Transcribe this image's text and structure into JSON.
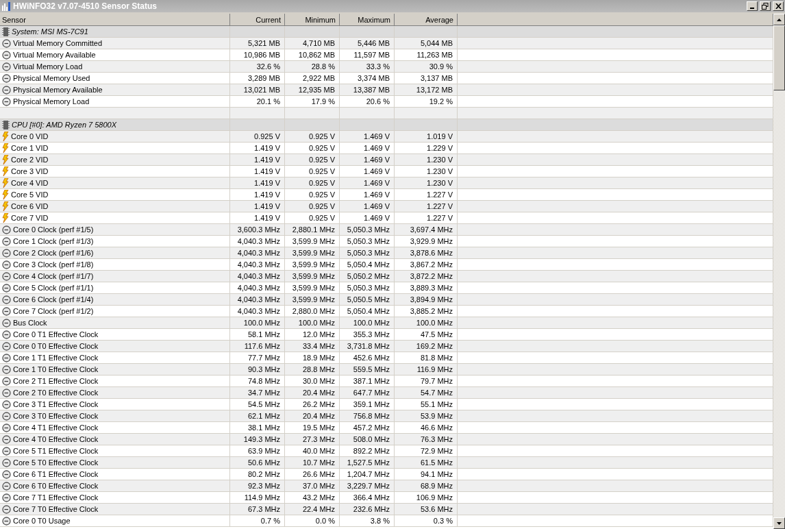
{
  "window": {
    "title": "HWiNFO32 v7.07-4510 Sensor Status"
  },
  "table": {
    "columns": [
      "Sensor",
      "Current",
      "Minimum",
      "Maximum",
      "Average"
    ],
    "rows": [
      {
        "kind": "group",
        "sensor": "System: MSI MS-7C91"
      },
      {
        "kind": "gauge",
        "sensor": "Virtual Memory Committed",
        "current": "5,321 MB",
        "minimum": "4,710 MB",
        "maximum": "5,446 MB",
        "average": "5,044 MB"
      },
      {
        "kind": "gauge",
        "sensor": "Virtual Memory Available",
        "current": "10,986 MB",
        "minimum": "10,862 MB",
        "maximum": "11,597 MB",
        "average": "11,263 MB"
      },
      {
        "kind": "gauge",
        "sensor": "Virtual Memory Load",
        "current": "32.6 %",
        "minimum": "28.8 %",
        "maximum": "33.3 %",
        "average": "30.9 %"
      },
      {
        "kind": "gauge",
        "sensor": "Physical Memory Used",
        "current": "3,289 MB",
        "minimum": "2,922 MB",
        "maximum": "3,374 MB",
        "average": "3,137 MB"
      },
      {
        "kind": "gauge",
        "sensor": "Physical Memory Available",
        "current": "13,021 MB",
        "minimum": "12,935 MB",
        "maximum": "13,387 MB",
        "average": "13,172 MB"
      },
      {
        "kind": "gauge",
        "sensor": "Physical Memory Load",
        "current": "20.1 %",
        "minimum": "17.9 %",
        "maximum": "20.6 %",
        "average": "19.2 %"
      },
      {
        "kind": "spacer"
      },
      {
        "kind": "group",
        "sensor": "CPU [#0]: AMD Ryzen 7 5800X"
      },
      {
        "kind": "voltage",
        "sensor": "Core 0 VID",
        "current": "0.925 V",
        "minimum": "0.925 V",
        "maximum": "1.469 V",
        "average": "1.019 V"
      },
      {
        "kind": "voltage",
        "sensor": "Core 1 VID",
        "current": "1.419 V",
        "minimum": "0.925 V",
        "maximum": "1.469 V",
        "average": "1.229 V"
      },
      {
        "kind": "voltage",
        "sensor": "Core 2 VID",
        "current": "1.419 V",
        "minimum": "0.925 V",
        "maximum": "1.469 V",
        "average": "1.230 V"
      },
      {
        "kind": "voltage",
        "sensor": "Core 3 VID",
        "current": "1.419 V",
        "minimum": "0.925 V",
        "maximum": "1.469 V",
        "average": "1.230 V"
      },
      {
        "kind": "voltage",
        "sensor": "Core 4 VID",
        "current": "1.419 V",
        "minimum": "0.925 V",
        "maximum": "1.469 V",
        "average": "1.230 V"
      },
      {
        "kind": "voltage",
        "sensor": "Core 5 VID",
        "current": "1.419 V",
        "minimum": "0.925 V",
        "maximum": "1.469 V",
        "average": "1.227 V"
      },
      {
        "kind": "voltage",
        "sensor": "Core 6 VID",
        "current": "1.419 V",
        "minimum": "0.925 V",
        "maximum": "1.469 V",
        "average": "1.227 V"
      },
      {
        "kind": "voltage",
        "sensor": "Core 7 VID",
        "current": "1.419 V",
        "minimum": "0.925 V",
        "maximum": "1.469 V",
        "average": "1.227 V"
      },
      {
        "kind": "gauge",
        "sensor": "Core 0 Clock (perf #1/5)",
        "current": "3,600.3 MHz",
        "minimum": "2,880.1 MHz",
        "maximum": "5,050.3 MHz",
        "average": "3,697.4 MHz"
      },
      {
        "kind": "gauge",
        "sensor": "Core 1 Clock (perf #1/3)",
        "current": "4,040.3 MHz",
        "minimum": "3,599.9 MHz",
        "maximum": "5,050.3 MHz",
        "average": "3,929.9 MHz"
      },
      {
        "kind": "gauge",
        "sensor": "Core 2 Clock (perf #1/6)",
        "current": "4,040.3 MHz",
        "minimum": "3,599.9 MHz",
        "maximum": "5,050.3 MHz",
        "average": "3,878.6 MHz"
      },
      {
        "kind": "gauge",
        "sensor": "Core 3 Clock (perf #1/8)",
        "current": "4,040.3 MHz",
        "minimum": "3,599.9 MHz",
        "maximum": "5,050.4 MHz",
        "average": "3,867.2 MHz"
      },
      {
        "kind": "gauge",
        "sensor": "Core 4 Clock (perf #1/7)",
        "current": "4,040.3 MHz",
        "minimum": "3,599.9 MHz",
        "maximum": "5,050.2 MHz",
        "average": "3,872.2 MHz"
      },
      {
        "kind": "gauge",
        "sensor": "Core 5 Clock (perf #1/1)",
        "current": "4,040.3 MHz",
        "minimum": "3,599.9 MHz",
        "maximum": "5,050.3 MHz",
        "average": "3,889.3 MHz"
      },
      {
        "kind": "gauge",
        "sensor": "Core 6 Clock (perf #1/4)",
        "current": "4,040.3 MHz",
        "minimum": "3,599.9 MHz",
        "maximum": "5,050.5 MHz",
        "average": "3,894.9 MHz"
      },
      {
        "kind": "gauge",
        "sensor": "Core 7 Clock (perf #1/2)",
        "current": "4,040.3 MHz",
        "minimum": "2,880.0 MHz",
        "maximum": "5,050.4 MHz",
        "average": "3,885.2 MHz"
      },
      {
        "kind": "gauge",
        "sensor": "Bus Clock",
        "current": "100.0 MHz",
        "minimum": "100.0 MHz",
        "maximum": "100.0 MHz",
        "average": "100.0 MHz"
      },
      {
        "kind": "gauge",
        "sensor": "Core 0 T1 Effective Clock",
        "current": "58.1 MHz",
        "minimum": "12.0 MHz",
        "maximum": "355.3 MHz",
        "average": "47.5 MHz"
      },
      {
        "kind": "gauge",
        "sensor": "Core 0 T0 Effective Clock",
        "current": "117.6 MHz",
        "minimum": "33.4 MHz",
        "maximum": "3,731.8 MHz",
        "average": "169.2 MHz"
      },
      {
        "kind": "gauge",
        "sensor": "Core 1 T1 Effective Clock",
        "current": "77.7 MHz",
        "minimum": "18.9 MHz",
        "maximum": "452.6 MHz",
        "average": "81.8 MHz"
      },
      {
        "kind": "gauge",
        "sensor": "Core 1 T0 Effective Clock",
        "current": "90.3 MHz",
        "minimum": "28.8 MHz",
        "maximum": "559.5 MHz",
        "average": "116.9 MHz"
      },
      {
        "kind": "gauge",
        "sensor": "Core 2 T1 Effective Clock",
        "current": "74.8 MHz",
        "minimum": "30.0 MHz",
        "maximum": "387.1 MHz",
        "average": "79.7 MHz"
      },
      {
        "kind": "gauge",
        "sensor": "Core 2 T0 Effective Clock",
        "current": "34.7 MHz",
        "minimum": "20.4 MHz",
        "maximum": "647.7 MHz",
        "average": "54.7 MHz"
      },
      {
        "kind": "gauge",
        "sensor": "Core 3 T1 Effective Clock",
        "current": "54.5 MHz",
        "minimum": "26.2 MHz",
        "maximum": "359.1 MHz",
        "average": "55.1 MHz"
      },
      {
        "kind": "gauge",
        "sensor": "Core 3 T0 Effective Clock",
        "current": "62.1 MHz",
        "minimum": "20.4 MHz",
        "maximum": "756.8 MHz",
        "average": "53.9 MHz"
      },
      {
        "kind": "gauge",
        "sensor": "Core 4 T1 Effective Clock",
        "current": "38.1 MHz",
        "minimum": "19.5 MHz",
        "maximum": "457.2 MHz",
        "average": "46.6 MHz"
      },
      {
        "kind": "gauge",
        "sensor": "Core 4 T0 Effective Clock",
        "current": "149.3 MHz",
        "minimum": "27.3 MHz",
        "maximum": "508.0 MHz",
        "average": "76.3 MHz"
      },
      {
        "kind": "gauge",
        "sensor": "Core 5 T1 Effective Clock",
        "current": "63.9 MHz",
        "minimum": "40.0 MHz",
        "maximum": "892.2 MHz",
        "average": "72.9 MHz"
      },
      {
        "kind": "gauge",
        "sensor": "Core 5 T0 Effective Clock",
        "current": "50.6 MHz",
        "minimum": "10.7 MHz",
        "maximum": "1,527.5 MHz",
        "average": "61.5 MHz"
      },
      {
        "kind": "gauge",
        "sensor": "Core 6 T1 Effective Clock",
        "current": "80.2 MHz",
        "minimum": "26.6 MHz",
        "maximum": "1,204.7 MHz",
        "average": "94.1 MHz"
      },
      {
        "kind": "gauge",
        "sensor": "Core 6 T0 Effective Clock",
        "current": "92.3 MHz",
        "minimum": "37.0 MHz",
        "maximum": "3,229.7 MHz",
        "average": "68.9 MHz"
      },
      {
        "kind": "gauge",
        "sensor": "Core 7 T1 Effective Clock",
        "current": "114.9 MHz",
        "minimum": "43.2 MHz",
        "maximum": "366.4 MHz",
        "average": "106.9 MHz"
      },
      {
        "kind": "gauge",
        "sensor": "Core 7 T0 Effective Clock",
        "current": "67.3 MHz",
        "minimum": "22.4 MHz",
        "maximum": "232.6 MHz",
        "average": "53.6 MHz"
      },
      {
        "kind": "gauge",
        "sensor": "Core 0 T0 Usage",
        "current": "0.7 %",
        "minimum": "0.0 %",
        "maximum": "3.8 %",
        "average": "0.3 %"
      }
    ]
  }
}
